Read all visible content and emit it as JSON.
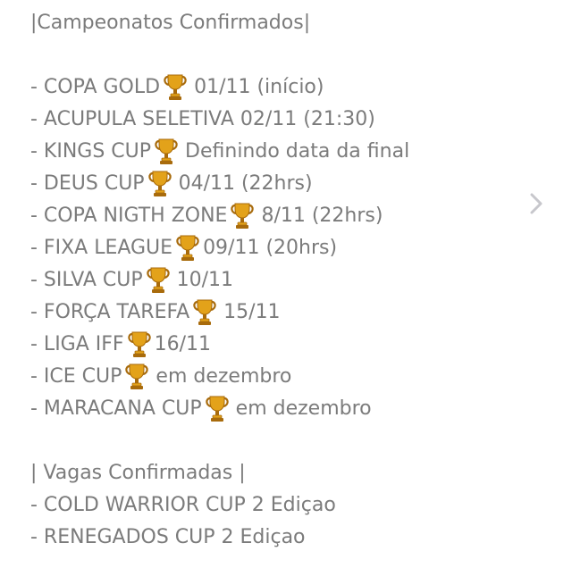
{
  "championships_header": "|Campeonatos Confirmados|",
  "championships": [
    {
      "name": "- COPA GOLD",
      "trophy": true,
      "detail": "01/11 (início)"
    },
    {
      "name": "- ACUPULA SELETIVA 02/11 (21:30)",
      "trophy": false,
      "detail": ""
    },
    {
      "name": "- KINGS CUP",
      "trophy": true,
      "detail": "Definindo data da final"
    },
    {
      "name": "- DEUS CUP",
      "trophy": true,
      "detail": "04/11 (22hrs)"
    },
    {
      "name": "- COPA NIGTH ZONE",
      "trophy": true,
      "detail": "8/11 (22hrs)"
    },
    {
      "name": "- FIXA LEAGUE",
      "trophy": true,
      "detail": "09/11 (20hrs)"
    },
    {
      "name": "- SILVA CUP",
      "trophy": true,
      "detail": "10/11"
    },
    {
      "name": "- FORÇA TAREFA",
      "trophy": true,
      "detail": "15/11"
    },
    {
      "name": "- LIGA IFF",
      "trophy": true,
      "detail": "16/11"
    },
    {
      "name": "- ICE CUP",
      "trophy": true,
      "detail": "em dezembro"
    },
    {
      "name": "- MARACANA CUP",
      "trophy": true,
      "detail": "em dezembro"
    }
  ],
  "slots_header": "| Vagas Confirmadas |",
  "slots": [
    "- COLD WARRIOR CUP 2 Ediçao",
    "- RENEGADOS CUP 2 Ediçao"
  ],
  "icons": {
    "trophy": "trophy-icon",
    "chevron": "chevron-right-icon"
  },
  "colors": {
    "text": "#7b7b7b",
    "trophy_gold": "#e3a21a",
    "trophy_dark": "#a86b0c",
    "chevron": "#c7c7cc"
  }
}
